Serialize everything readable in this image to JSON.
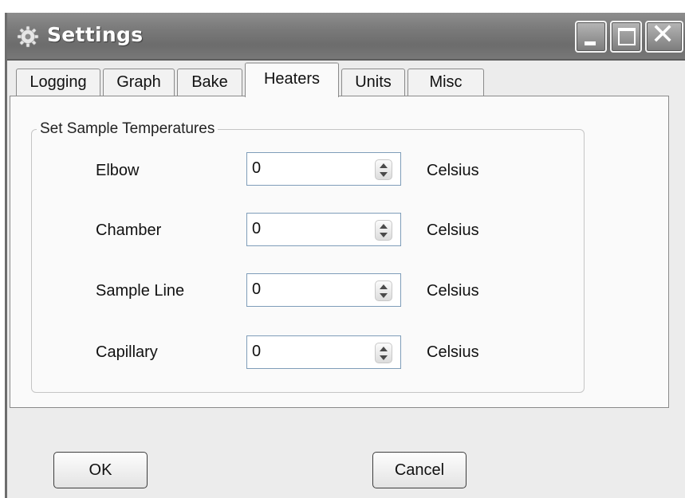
{
  "window": {
    "title": "Settings",
    "title_icon": "gear-icon",
    "controls": {
      "minimize": "minimize-icon",
      "maximize": "maximize-icon",
      "close": "close-icon",
      "close_glyph": "✕"
    }
  },
  "tabs": [
    {
      "label": "Logging",
      "active": false
    },
    {
      "label": "Graph",
      "active": false
    },
    {
      "label": "Bake",
      "active": false
    },
    {
      "label": "Heaters",
      "active": true
    },
    {
      "label": "Units",
      "active": false
    },
    {
      "label": "Misc",
      "active": false
    }
  ],
  "group": {
    "legend": "Set Sample Temperatures",
    "rows": [
      {
        "label": "Elbow",
        "value": "0",
        "unit": "Celsius"
      },
      {
        "label": "Chamber",
        "value": "0",
        "unit": "Celsius"
      },
      {
        "label": "Sample Line",
        "value": "0",
        "unit": "Celsius"
      },
      {
        "label": "Capillary",
        "value": "0",
        "unit": "Celsius"
      }
    ]
  },
  "buttons": {
    "ok": "OK",
    "cancel": "Cancel"
  },
  "colors": {
    "titlebar": "#7a7a7a",
    "window_bg": "#ececec",
    "panel_bg": "#fafafa",
    "input_border": "#7f9db9"
  }
}
